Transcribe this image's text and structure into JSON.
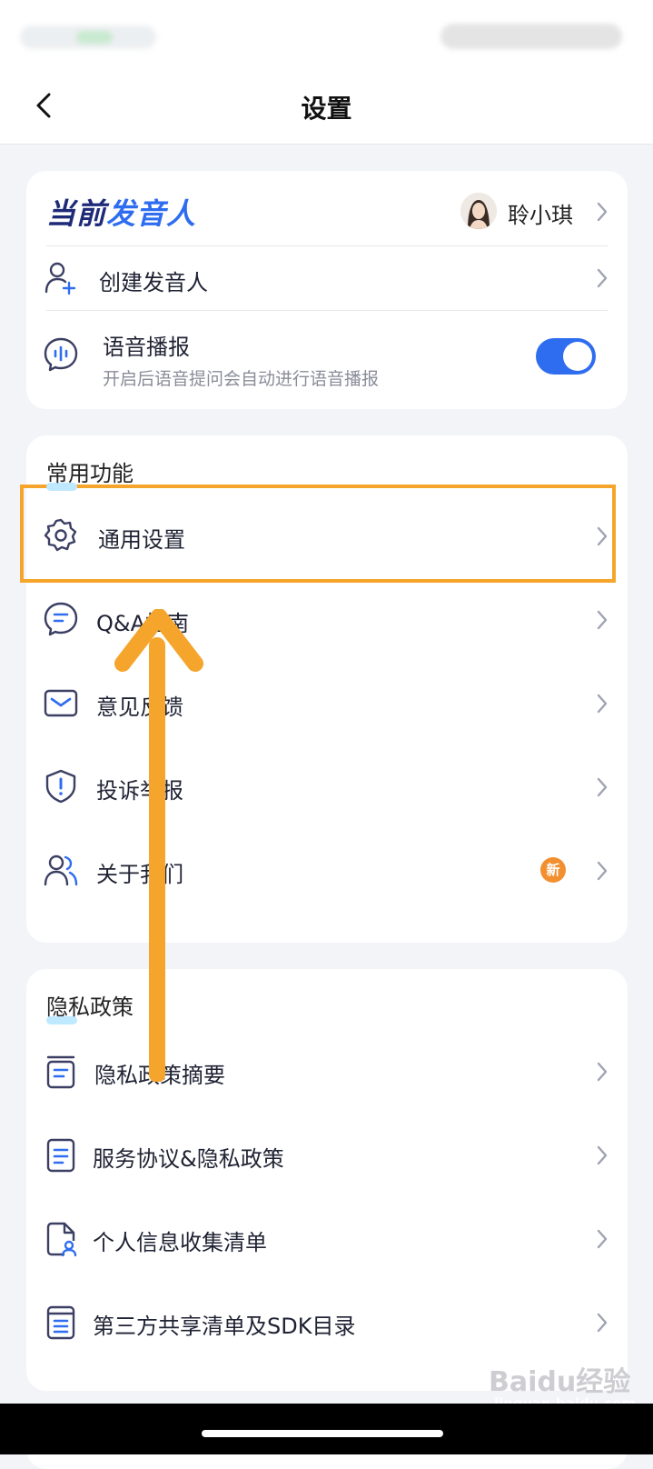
{
  "nav": {
    "title": "设置"
  },
  "speaker": {
    "brand_part1": "当前",
    "brand_part2": "发音人",
    "name": "聆小琪",
    "create_label": "创建发音人",
    "voice_label": "语音播报",
    "voice_desc": "开启后语音提问会自动进行语音播报",
    "voice_enabled": true
  },
  "common": {
    "title": "常用功能",
    "items": [
      {
        "label": "通用设置",
        "icon": "gear-icon"
      },
      {
        "label": "Q&A指南",
        "icon": "chat-bubble-icon"
      },
      {
        "label": "意见反馈",
        "icon": "mail-icon"
      },
      {
        "label": "投诉举报",
        "icon": "shield-alert-icon"
      },
      {
        "label": "关于我们",
        "icon": "users-icon",
        "badge": "新"
      }
    ]
  },
  "privacy": {
    "title": "隐私政策",
    "items": [
      {
        "label": "隐私政策摘要",
        "icon": "document-summary-icon"
      },
      {
        "label": "服务协议&隐私政策",
        "icon": "document-icon"
      },
      {
        "label": "个人信息收集清单",
        "icon": "person-document-icon"
      },
      {
        "label": "第三方共享清单及SDK目录",
        "icon": "list-box-icon"
      }
    ]
  },
  "watermark": {
    "logo": "Baidu经验",
    "url": "jingyan.baidu.com"
  },
  "colors": {
    "accent": "#2f6df0",
    "highlight": "#f5a52b",
    "brand_dark": "#1e2a78",
    "badge": "#f2902f"
  }
}
